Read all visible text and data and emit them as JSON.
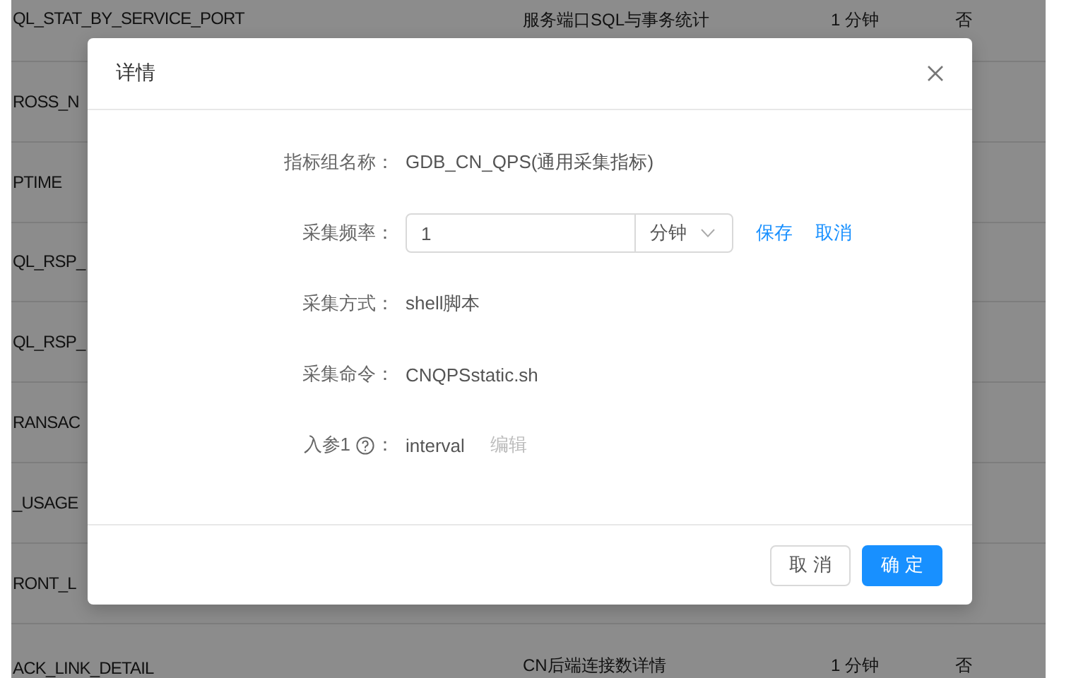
{
  "background_table": {
    "rows": [
      {
        "column_1": "QL_STAT_BY_SERVICE_PORT",
        "column_2": "服务端口SQL与事务统计",
        "column_3": "1 分钟",
        "column_4": "否"
      },
      {
        "column_1": "ROSS_N"
      },
      {
        "column_1": "PTIME"
      },
      {
        "column_1": "QL_RSP_"
      },
      {
        "column_1": "QL_RSP_"
      },
      {
        "column_1": "RANSAC"
      },
      {
        "column_1": "_USAGE"
      },
      {
        "column_1": "RONT_L"
      },
      {
        "column_1": "ACK_LINK_DETAIL",
        "column_2": "CN后端连接数详情",
        "column_3": "1 分钟",
        "column_4": "否"
      }
    ]
  },
  "modal": {
    "title": "详情",
    "fields": [
      {
        "kind": "text",
        "label": "指标组名称：",
        "value": "GDB_CN_QPS(通用采集指标)"
      },
      {
        "kind": "frequency",
        "label": "采集频率：",
        "value": "1",
        "unit": "分钟",
        "actions": [
          "保存",
          "取消"
        ]
      },
      {
        "kind": "text",
        "label": "采集方式：",
        "value": "shell脚本"
      },
      {
        "kind": "text",
        "label": "采集命令：",
        "value": "CNQPSstatic.sh"
      },
      {
        "kind": "param",
        "label": "入参1",
        "label_suffix": "：",
        "value": "interval",
        "action": "编辑",
        "action_disabled": true
      }
    ],
    "buttons": [
      {
        "label": "取 消",
        "kind": "default"
      },
      {
        "label": "确 定",
        "kind": "primary"
      }
    ]
  }
}
